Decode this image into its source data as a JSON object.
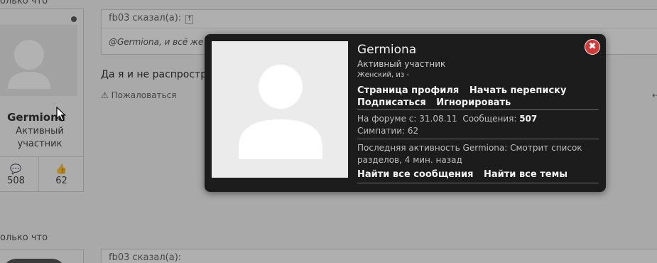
{
  "background": {
    "timestamp_top": "олько что",
    "timestamp_bottom": "олько что",
    "user_card": {
      "name": "Germiona",
      "title": "Активный участник",
      "messages_count": "508",
      "likes_count": "62"
    },
    "quote": {
      "author_label": "fb03 сказал(а):",
      "up_arrow": "↑",
      "text": "@Germiona, и всё же кричать на весь форум о том... а вот ... делайте полезное молча"
    },
    "post_text": "Да я и не распространяюсь, просто было смешно, когда зорошиза про тюремные нары рассказ",
    "report_label": "Пожаловаться",
    "quote2_author_label": "fb03 сказал(а):"
  },
  "popup": {
    "name": "Germiona",
    "title": "Активный участник",
    "gender_location": "Женский, из -",
    "close_label": "✖",
    "links_row1": [
      "Страница профиля",
      "Начать переписку"
    ],
    "links_row2": [
      "Подписаться",
      "Игнорировать"
    ],
    "on_forum_label": "На форуме с:",
    "on_forum_value": "31.08.11",
    "messages_label": "Сообщения:",
    "messages_value": "507",
    "likes_label": "Симпатии:",
    "likes_value": "62",
    "activity": "Последняя активность Germiona: Смотрит список разделов, 4 мин. назад",
    "links_row3": [
      "Найти все сообщения",
      "Найти все темы"
    ]
  },
  "colors": {
    "popup_bg": "#1c1c1c",
    "close_button": "#d23a3a",
    "overlay": "rgba(0,0,0,0.30)"
  }
}
